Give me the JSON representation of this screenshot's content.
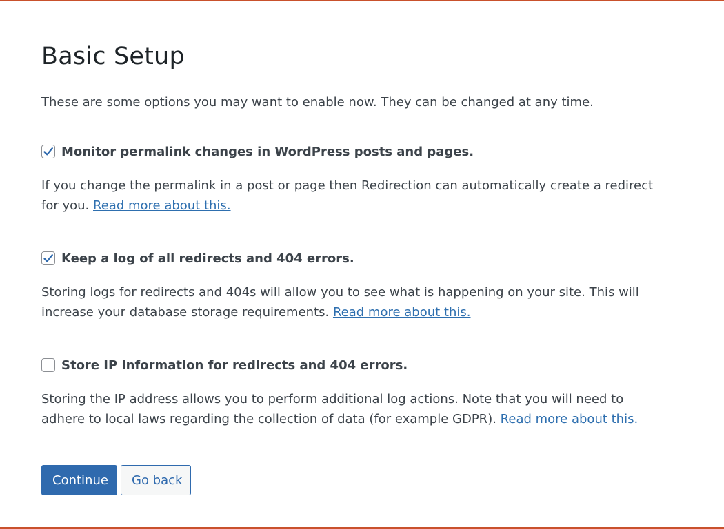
{
  "colors": {
    "accent": "#2f6aae",
    "link": "#2e6faf",
    "rule": "#c9512c",
    "text": "#3c434a",
    "heading": "#1d2327"
  },
  "page": {
    "title": "Basic Setup",
    "intro": "These are some options you may want to enable now. They can be changed at any time."
  },
  "options": [
    {
      "label": "Monitor permalink changes in WordPress posts and pages.",
      "checked": true,
      "description": "If you change the permalink in a post or page then Redirection can automatically create a redirect for you.",
      "link_text": "Read more about this."
    },
    {
      "label": "Keep a log of all redirects and 404 errors.",
      "checked": true,
      "description": "Storing logs for redirects and 404s will allow you to see what is happening on your site. This will increase your database storage requirements.",
      "link_text": "Read more about this."
    },
    {
      "label": "Store IP information for redirects and 404 errors.",
      "checked": false,
      "description": "Storing the IP address allows you to perform additional log actions. Note that you will need to adhere to local laws regarding the collection of data (for example GDPR).",
      "link_text": "Read more about this."
    }
  ],
  "buttons": {
    "continue_label": "Continue",
    "back_label": "Go back"
  }
}
